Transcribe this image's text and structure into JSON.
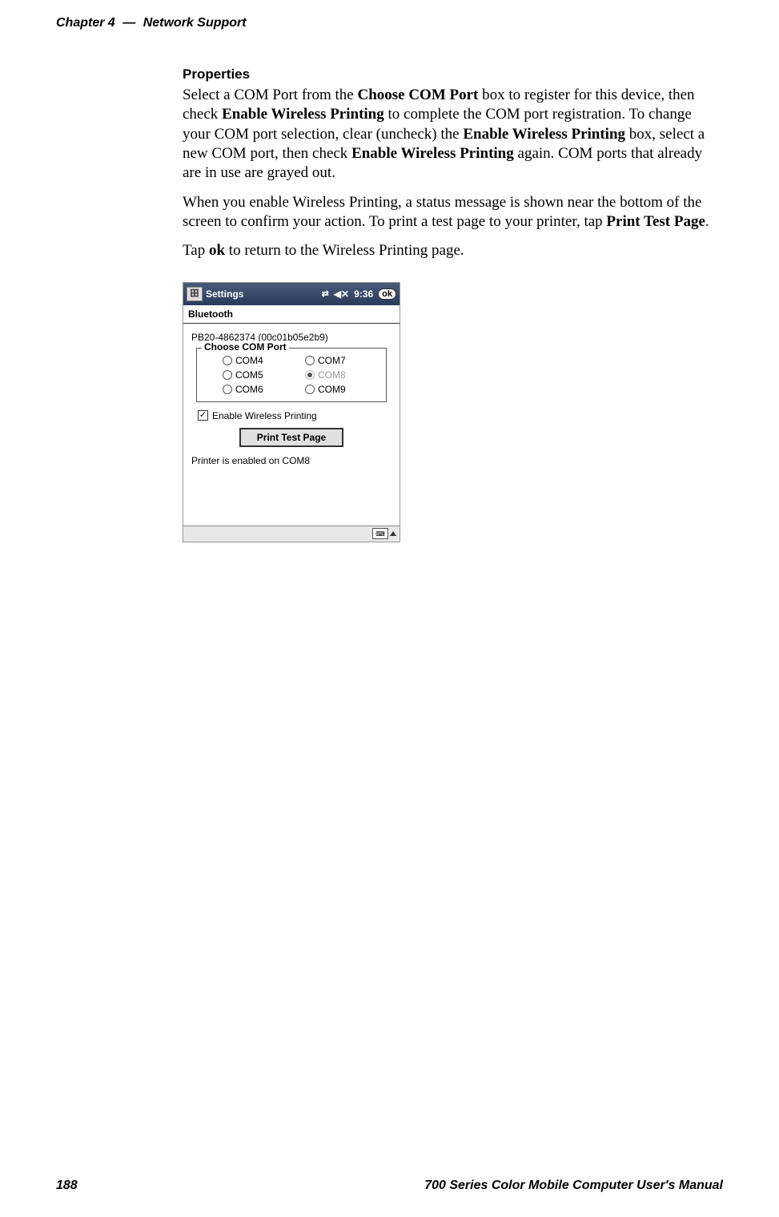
{
  "header": {
    "chapter": "Chapter 4",
    "separator": "—",
    "title": "Network Support"
  },
  "section": {
    "title": "Properties",
    "para1_a": "Select a COM Port from the ",
    "para1_b1": "Choose COM Port",
    "para1_c": " box to register for this device, then check ",
    "para1_b2": "Enable Wireless Printing",
    "para1_d": " to complete the COM port registration. To change your COM port selection, clear (uncheck) the ",
    "para1_b3": "Enable Wireless Printing",
    "para1_e": " box, select a new COM port, then check ",
    "para1_b4": "Enable Wireless Printing",
    "para1_f": " again. COM ports that already are in use are grayed out.",
    "para2_a": "When you enable Wireless Printing, a status message is shown near the bottom of the screen to confirm your action. To print a test page to your printer, tap ",
    "para2_b1": "Print Test Page",
    "para2_c": ".",
    "para3_a": "Tap ",
    "para3_b1": "ok",
    "para3_c": " to return to the Wireless Printing page."
  },
  "screenshot": {
    "titlebar": {
      "title": "Settings",
      "time": "9:36",
      "ok": "ok"
    },
    "subheader": "Bluetooth",
    "device": "PB20-4862374 (00c01b05e2b9)",
    "fieldset_legend": "Choose COM Port",
    "com_options": [
      {
        "label": "COM4",
        "selected": false,
        "disabled": false
      },
      {
        "label": "COM7",
        "selected": false,
        "disabled": false
      },
      {
        "label": "COM5",
        "selected": false,
        "disabled": false
      },
      {
        "label": "COM8",
        "selected": true,
        "disabled": true
      },
      {
        "label": "COM6",
        "selected": false,
        "disabled": false
      },
      {
        "label": "COM9",
        "selected": false,
        "disabled": false
      }
    ],
    "checkbox_label": "Enable Wireless Printing",
    "checkbox_checked": true,
    "print_button": "Print Test Page",
    "status": "Printer is enabled on COM8"
  },
  "footer": {
    "page_number": "188",
    "manual_title": "700 Series Color Mobile Computer User's Manual"
  }
}
